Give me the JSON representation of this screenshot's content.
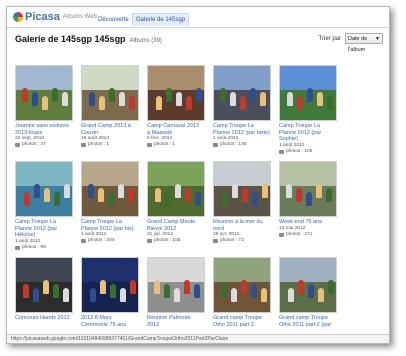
{
  "app": {
    "logo": "Picasa",
    "logo_sub": "Albums Web"
  },
  "tabs": [
    {
      "label": "Découverte"
    },
    {
      "label": "Galerie de 145sgp"
    }
  ],
  "header": {
    "title": "Galerie de 145sgp 145sgp",
    "albums_count": "Albums (39)"
  },
  "sort": {
    "label": "Trier par",
    "value": "Date de l'album"
  },
  "albums": [
    {
      "title_line1": "Journée sans voitures",
      "title_line2": "2013-loups",
      "date": "22 sept. 2013",
      "photos": "photos : 47",
      "sky": "#9fb8cf",
      "ground": "#5e7d3e"
    },
    {
      "title_line1": "Grand Camp 2013 à",
      "title_line2": "Couvin",
      "date": "15 août 2013",
      "photos": "photos : 1",
      "sky": "#cfd9c4",
      "ground": "#7c6a4c"
    },
    {
      "title_line1": "Camp Carnaval 2013",
      "title_line2": "à Maaseik",
      "date": "9 févr. 2013",
      "photos": "photos : 1",
      "sky": "#a98e6c",
      "ground": "#5b3b2b"
    },
    {
      "title_line1": "Camp Troupe La",
      "title_line2": "Planne 2012 (par bixie)",
      "date": "1 août 2012",
      "photos": "photos : 145",
      "sky": "#7f9fc8",
      "ground": "#4b4f5c"
    },
    {
      "title_line1": "Camp Troupe La",
      "title_line2": "Planne 2012 (par Sophie)",
      "date": "1 août 2012",
      "photos": "photos : 106",
      "sky": "#5b8fd6",
      "ground": "#3f7a3a"
    },
    {
      "title_line1": "Camp Troupe La",
      "title_line2": "Planne 2012 (par Héloïse)",
      "date": "1 août 2012",
      "photos": "photos : 99",
      "sky": "#7fb6c4",
      "ground": "#3c7fa0"
    },
    {
      "title_line1": "Camp Troupe La",
      "title_line2": "Planne 2012 (par bis)",
      "date": "1 août 2012",
      "photos": "photos : 204",
      "sky": "#b6a78a",
      "ground": "#6d5a3d"
    },
    {
      "title_line1": "Grand Camp Meute",
      "title_line2": "Bièvre 2012",
      "date": "31 juil. 2012",
      "photos": "photos : 105",
      "sky": "#7da35b",
      "ground": "#4f6b30"
    },
    {
      "title_line1": "Réunion à la mer du",
      "title_line2": "nord",
      "date": "28 avr. 2012",
      "photos": "photos : 73",
      "sky": "#c6ccd0",
      "ground": "#5a5348"
    },
    {
      "title_line1": "Week-end 75 ans",
      "title_line2": "",
      "date": "13 mai 2012",
      "photos": "photos : 271",
      "sky": "#b5c2a4",
      "ground": "#6b7a58"
    },
    {
      "title_line1": "Concours Hands 2012",
      "title_line2": "",
      "date": "",
      "photos": "",
      "sky": "#3d4650",
      "ground": "#2c2c2c"
    },
    {
      "title_line1": "2012 8 Mars",
      "title_line2": "Cérémonie 75 ans",
      "date": "",
      "photos": "",
      "sky": "#1f2f6b",
      "ground": "#16224f"
    },
    {
      "title_line1": "Réunion Patinoire",
      "title_line2": "2012",
      "date": "",
      "photos": "",
      "sky": "#d8d8d8",
      "ground": "#8f8f8f"
    },
    {
      "title_line1": "Grand camp Troupe",
      "title_line2": "Otho 2011 part 2",
      "date": "",
      "photos": "",
      "sky": "#8fa37a",
      "ground": "#6d5535"
    },
    {
      "title_line1": "Grand camp Troupe",
      "title_line2": "Otho 2011 part 2 (par",
      "date": "",
      "photos": "",
      "sky": "#9fb0bf",
      "ground": "#5c6e48"
    }
  ],
  "status": {
    "url": "https://picasaweb.google.com/110104849989377451/GrandCampTroupeOrtho2011Part2ParClaire"
  }
}
